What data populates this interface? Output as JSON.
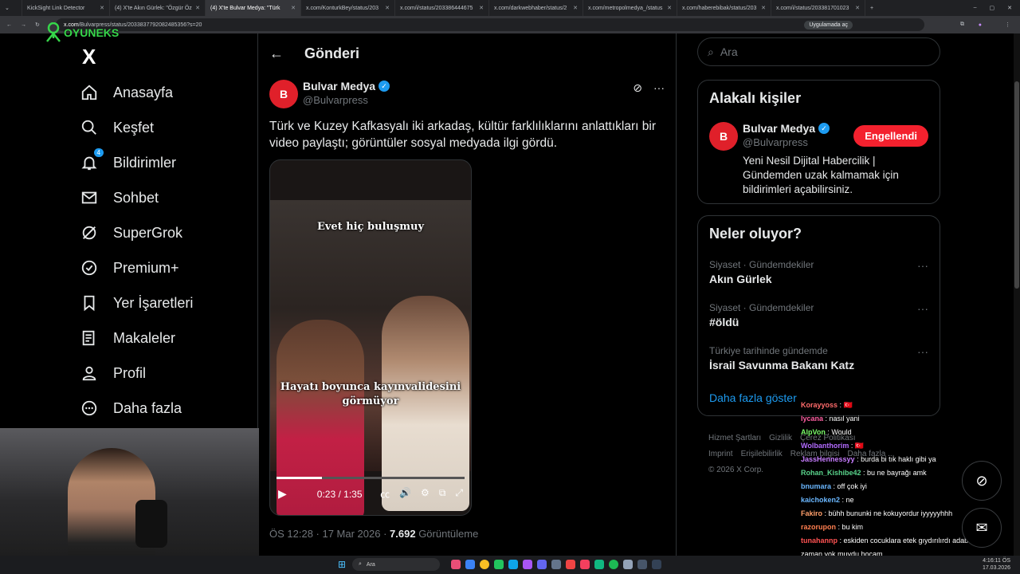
{
  "browser": {
    "tabs": [
      {
        "label": "KickSight Link Detector",
        "active": false
      },
      {
        "label": "(4) X'te Akın Gürlek: \"Özgür Öz",
        "active": false
      },
      {
        "label": "(4) X'te Bulvar Medya: \"Türk",
        "active": true
      },
      {
        "label": "x.com/KonturkBey/status/203",
        "active": false
      },
      {
        "label": "x.com/i/status/203386444675",
        "active": false
      },
      {
        "label": "x.com/darkwebhaber/status/2",
        "active": false
      },
      {
        "label": "x.com/metropolmedya_/status",
        "active": false
      },
      {
        "label": "x.com/haberebibak/status/203",
        "active": false
      },
      {
        "label": "x.com/i/status/203381701023",
        "active": false
      }
    ],
    "url_host": "x.com",
    "url_path": "/Bulvarpress/status/2033837792082485356?s=20",
    "open_app": "Uygulamada aç"
  },
  "overlay": {
    "brand": "OYUNEKS"
  },
  "nav": {
    "logo": "X",
    "items": [
      {
        "label": "Anasayfa",
        "icon": "home-icon"
      },
      {
        "label": "Keşfet",
        "icon": "search-icon"
      },
      {
        "label": "Bildirimler",
        "icon": "bell-icon",
        "badge": "4"
      },
      {
        "label": "Sohbet",
        "icon": "mail-icon"
      },
      {
        "label": "SuperGrok",
        "icon": "grok-icon"
      },
      {
        "label": "Premium+",
        "icon": "premium-icon"
      },
      {
        "label": "Yer İşaretleri",
        "icon": "bookmark-icon"
      },
      {
        "label": "Makaleler",
        "icon": "article-icon"
      },
      {
        "label": "Profil",
        "icon": "profile-icon"
      },
      {
        "label": "Daha fazla",
        "icon": "more-icon"
      }
    ]
  },
  "post": {
    "header_title": "Gönderi",
    "author_name": "Bulvar Medya",
    "author_handle": "@Bulvarpress",
    "text": "Türk ve Kuzey Kafkasyalı iki arkadaş, kültür farklılıklarını anlattıkları bir video paylaştı; görüntüler sosyal medyada ilgi gördü.",
    "video": {
      "caption_top": "Evet hiç buluşmuy",
      "caption_bottom": "Hayatı boyunca kayınvalidesini görmüyor",
      "time": "0:23 / 1:35",
      "progress": 0.24
    },
    "timestamp": "ÖS 12:28 · 17 Mar 2026 · ",
    "views": "7.692",
    "views_label": " Görüntüleme"
  },
  "sidebar": {
    "search_placeholder": "Ara",
    "related_title": "Alakalı kişiler",
    "related_name": "Bulvar Medya",
    "related_handle": "@Bulvarpress",
    "related_button": "Engellendi",
    "related_desc": "Yeni Nesil Dijital Habercilik | Gündemden uzak kalmamak için bildirimleri açabilirsiniz.",
    "trending_title": "Neler oluyor?",
    "trends": [
      {
        "context": "Siyaset · Gündemdekiler",
        "title": "Akın Gürlek"
      },
      {
        "context": "Siyaset · Gündemdekiler",
        "title": "#öldü"
      },
      {
        "context": "Türkiye tarihinde gündemde",
        "title": "İsrail Savunma Bakanı Katz"
      }
    ],
    "show_more": "Daha fazla göster",
    "footer": [
      "Hizmet Şartları",
      "Gizlilik",
      "Çerez Politikası",
      "Imprint",
      "Erişilebilirlik",
      "Reklam bilgisi",
      "Daha fazla ...",
      "© 2026 X Corp."
    ]
  },
  "chat": [
    {
      "user": "Korayyoss",
      "msg": " : 🇹🇷",
      "color": "#ff6b6b"
    },
    {
      "user": "lycana",
      "msg": " : nasıl yani",
      "color": "#ff5fa2"
    },
    {
      "user": "AlpVon",
      "msg": " : Would",
      "color": "#7cfc6a"
    },
    {
      "user": "Wolbanthorim",
      "msg": " : 🇹🇷",
      "color": "#b36bff"
    },
    {
      "user": "JassHennessyy",
      "msg": " : burda bi tık haklı gibi ya",
      "color": "#c77dff"
    },
    {
      "user": "Rohan_Kishibe42",
      "msg": " : bu ne bayrağı amk",
      "color": "#59d38b"
    },
    {
      "user": "bnumara",
      "msg": " : off çok iyi",
      "color": "#6ab7ff"
    },
    {
      "user": "kaichoken2",
      "msg": " : ne",
      "color": "#6ab7ff"
    },
    {
      "user": "Fakiro",
      "msg": " : bühh bununki ne kokuyordur iyyyyyhhh",
      "color": "#ff9f6b"
    },
    {
      "user": "razorupon",
      "msg": " : bu kim",
      "color": "#ff7f50"
    },
    {
      "user": "tunahannp",
      "msg": " : eskiden cocuklara etek gıydırılırdı adabı şeref o zaman yok muydu hocam",
      "color": "#ff5252"
    }
  ],
  "taskbar": {
    "search": "Ara",
    "time": "4:16:11 ÖS",
    "date": "17.03.2026"
  }
}
